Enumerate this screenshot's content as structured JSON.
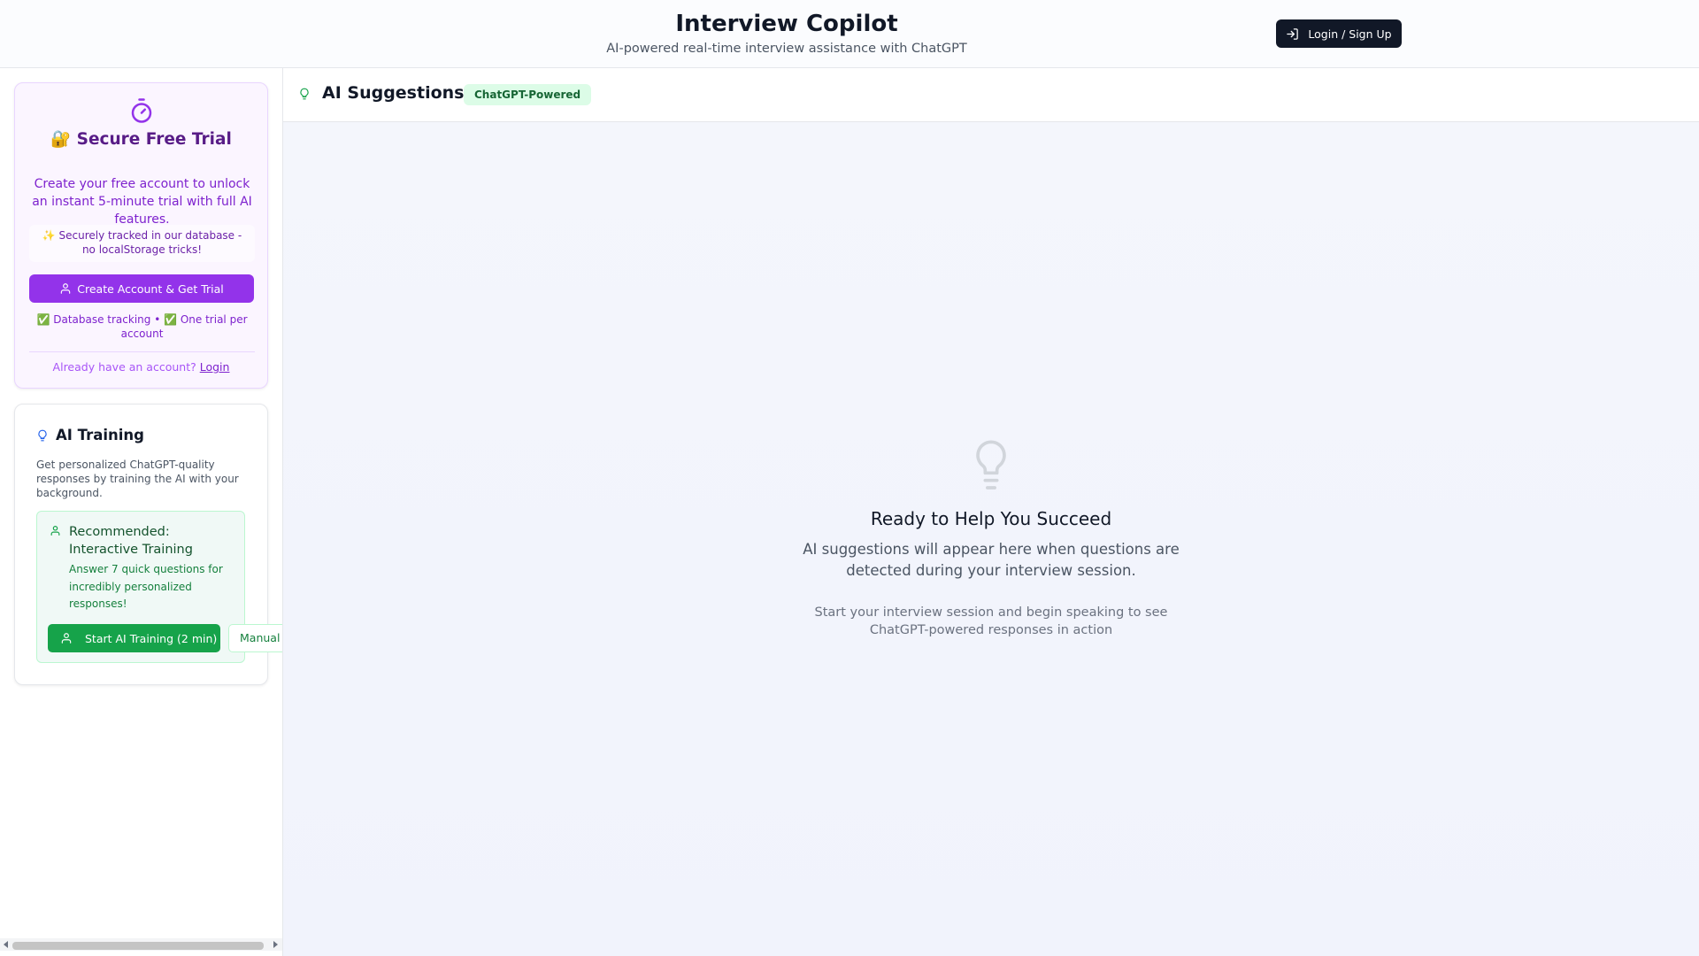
{
  "header": {
    "title": "Interview Copilot",
    "subtitle": "AI-powered real-time interview assistance with ChatGPT",
    "login_label": "Login / Sign Up"
  },
  "trial": {
    "title": "🔐 Secure Free Trial",
    "description": "Create your free account to unlock an instant 5-minute trial with full AI features.",
    "note": "✨ Securely tracked in our database - no localStorage tricks!",
    "create_label": "Create Account & Get Trial",
    "checks": "✅ Database tracking • ✅ One trial per account",
    "login_prompt": "Already have an account?",
    "login_link": "Login"
  },
  "training": {
    "title": "AI Training",
    "description": "Get personalized ChatGPT-quality responses by training the AI with your background.",
    "rec_title": "Recommended: Interactive Training",
    "rec_desc": "Answer 7 quick questions for incredibly personalized responses!",
    "start_label": "Start AI Training (2 min)",
    "manual_label": "Manual"
  },
  "main": {
    "title": "AI Suggestions",
    "badge": "ChatGPT-Powered",
    "empty_title": "Ready to Help You Succeed",
    "empty_desc": "AI suggestions will appear here when questions are detected during your interview session.",
    "empty_hint": "Start your interview session and begin speaking to see ChatGPT-powered responses in action"
  },
  "colors": {
    "purple_accent": "#9333ea",
    "green_accent": "#16a34a",
    "dark_button": "#111827"
  },
  "icons": {
    "login": "log-in-icon",
    "timer": "timer-icon",
    "user": "user-icon",
    "bulb": "lightbulb-icon"
  }
}
